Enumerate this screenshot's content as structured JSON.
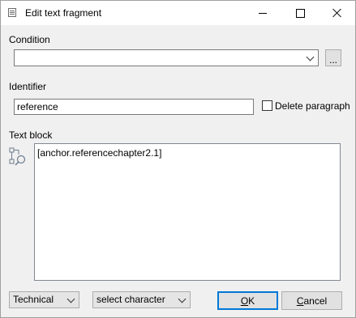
{
  "window": {
    "title": "Edit text fragment",
    "controls": {
      "minimize": "minimize",
      "maximize": "maximize",
      "close": "close"
    }
  },
  "condition": {
    "label": "Condition",
    "value": "",
    "browse_label": "..."
  },
  "identifier": {
    "label": "Identifier",
    "value": "reference",
    "delete_paragraph_label": "Delete paragraph",
    "delete_paragraph_checked": false
  },
  "text_block": {
    "label": "Text block",
    "content": "[anchor.referencechapter2.1]"
  },
  "footer": {
    "mode_select": "Technical",
    "character_select": "select character",
    "ok_label_prefix": "",
    "ok_label_underlined": "O",
    "ok_label_rest": "K",
    "cancel_label_underlined": "C",
    "cancel_label_rest": "ancel"
  },
  "icons": {
    "title": "dialog-icon",
    "text_block_side": "tree-search-icon"
  },
  "colors": {
    "accent": "#0078d7",
    "dialog_bg": "#f0f0f0"
  }
}
